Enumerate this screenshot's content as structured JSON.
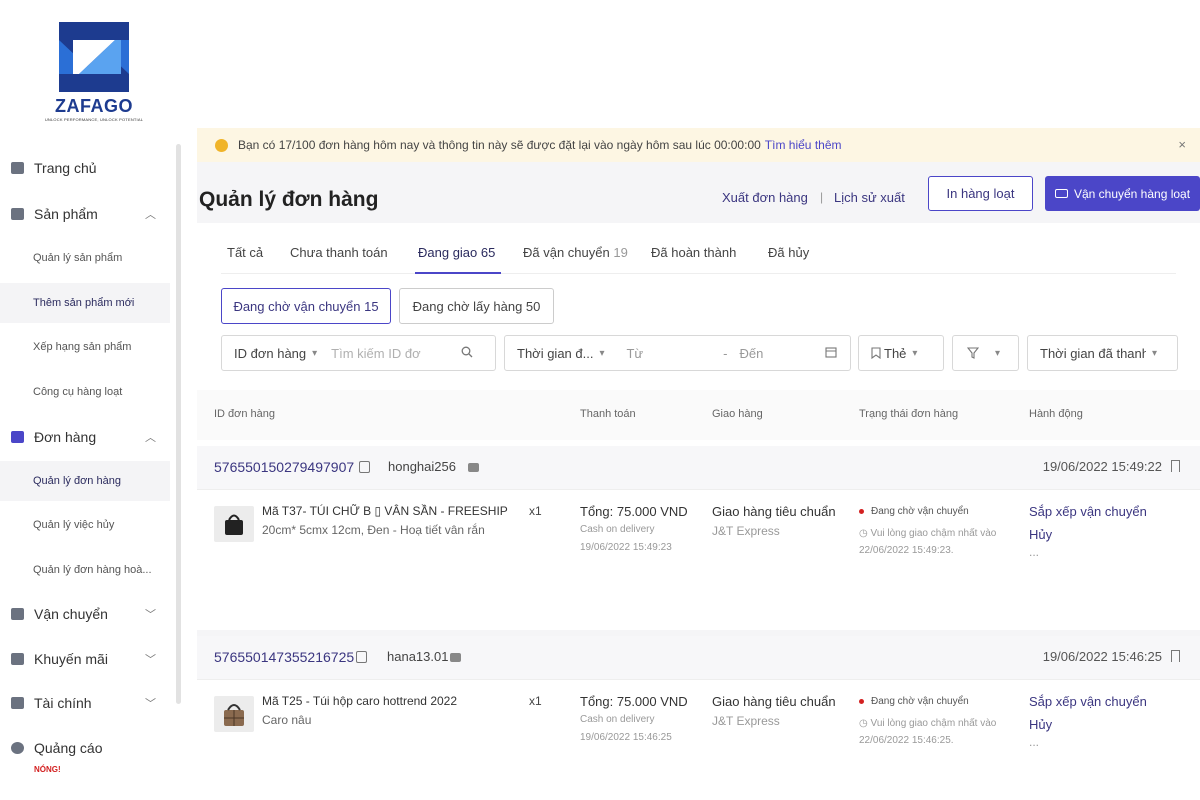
{
  "logo": {
    "word": "ZAFAGO",
    "tagline": "UNLOCK PERFORMANCE, UNLOCK POTENTIAL"
  },
  "sidebar": {
    "items": [
      {
        "label": "Trang chủ",
        "icon": "home-icon"
      },
      {
        "label": "Sản phẩm",
        "icon": "product-icon"
      },
      {
        "label": "Quản lý sản phẩm"
      },
      {
        "label": "Thêm sản phẩm mới"
      },
      {
        "label": "Xếp hạng sản phẩm"
      },
      {
        "label": "Công cụ hàng loạt"
      },
      {
        "label": "Đơn hàng",
        "icon": "order-icon"
      },
      {
        "label": "Quản lý đơn hàng"
      },
      {
        "label": "Quản lý việc hủy"
      },
      {
        "label": "Quản lý đơn hàng hoà..."
      },
      {
        "label": "Vận chuyển",
        "icon": "truck-icon"
      },
      {
        "label": "Khuyến mãi",
        "icon": "megaphone-icon"
      },
      {
        "label": "Tài chính",
        "icon": "wallet-icon"
      },
      {
        "label": "Quảng cáo",
        "icon": "ads-icon"
      }
    ],
    "hot_badge": "NÓNG!",
    "expand_open": "︿",
    "expand_closed": "﹀"
  },
  "notice": {
    "text": "Bạn có 17/100 đơn hàng hôm nay và thông tin này sẽ được đặt lại vào ngày hôm sau lúc 00:00:00",
    "link": "Tìm hiểu thêm",
    "close": "×"
  },
  "header": {
    "title": "Quản lý đơn hàng",
    "export_link": "Xuất đơn hàng",
    "separator": "|",
    "history_link": "Lịch sử xuất",
    "bulk_print": "In hàng loạt",
    "bulk_ship": "Vận chuyển hàng loạt"
  },
  "tabs": [
    {
      "label": "Tất cả",
      "count": ""
    },
    {
      "label": "Chưa thanh toán",
      "count": ""
    },
    {
      "label": "Đang giao",
      "count": "65"
    },
    {
      "label": "Đã vận chuyển",
      "count": "19"
    },
    {
      "label": "Đã hoàn thành",
      "count": ""
    },
    {
      "label": "Đã hủy",
      "count": ""
    }
  ],
  "subtabs": [
    {
      "label": "Đang chờ vận chuyển 15"
    },
    {
      "label": "Đang chờ lấy hàng 50"
    }
  ],
  "filters": {
    "id_select": "ID đơn hàng",
    "search_placeholder": "Tìm kiếm ID đơ",
    "time_select": "Thời gian đ...",
    "from": "Từ",
    "dash": "-",
    "to": "Đến",
    "tag": "Thẻ",
    "period": "Thời gian đã thanh"
  },
  "table_headers": [
    "ID đơn hàng",
    "Thanh toán",
    "Giao hàng",
    "Trạng thái đơn hàng",
    "Hành động"
  ],
  "orders": [
    {
      "id": "576550150279497907",
      "user": "honghai256",
      "time": "19/06/2022 15:49:22",
      "product": "Mã T37- TÚI CHỮ B ▯ VÂN SẦN - FREESHIP",
      "variant": "20cm* 5cmx 12cm, Đen - Hoạ tiết vân rắn",
      "qty": "x1",
      "total": "Tổng: 75.000 VND",
      "payment": "Cash on delivery",
      "pay_date": "19/06/2022 15:49:23",
      "shipping": "Giao hàng tiêu chuẩn",
      "carrier": "J&T Express",
      "status": "Đang chờ vận chuyển",
      "note": "Vui lòng giao chậm nhất vào 22/06/2022 15:49:23.",
      "action_ship": "Sắp xếp vận chuyển",
      "action_cancel": "Hủy",
      "more": "..."
    },
    {
      "id": "576550147355216725",
      "user": "hana13.01",
      "time": "19/06/2022 15:46:25",
      "product": "Mã T25 - Túi hộp caro hottrend 2022",
      "variant": "Caro nâu",
      "qty": "x1",
      "total": "Tổng: 75.000 VND",
      "payment": "Cash on delivery",
      "pay_date": "19/06/2022 15:46:25",
      "shipping": "Giao hàng tiêu chuẩn",
      "carrier": "J&T Express",
      "status": "Đang chờ vận chuyển",
      "note": "Vui lòng giao chậm nhất vào 22/06/2022 15:46:25.",
      "action_ship": "Sắp xếp vận chuyển",
      "action_cancel": "Hủy",
      "more": "..."
    }
  ],
  "colors": {
    "accent": "#4b46c8",
    "brand_blue": "#1d3b8f",
    "notice_bg": "#fdf6e3",
    "status_red": "#d32020"
  }
}
